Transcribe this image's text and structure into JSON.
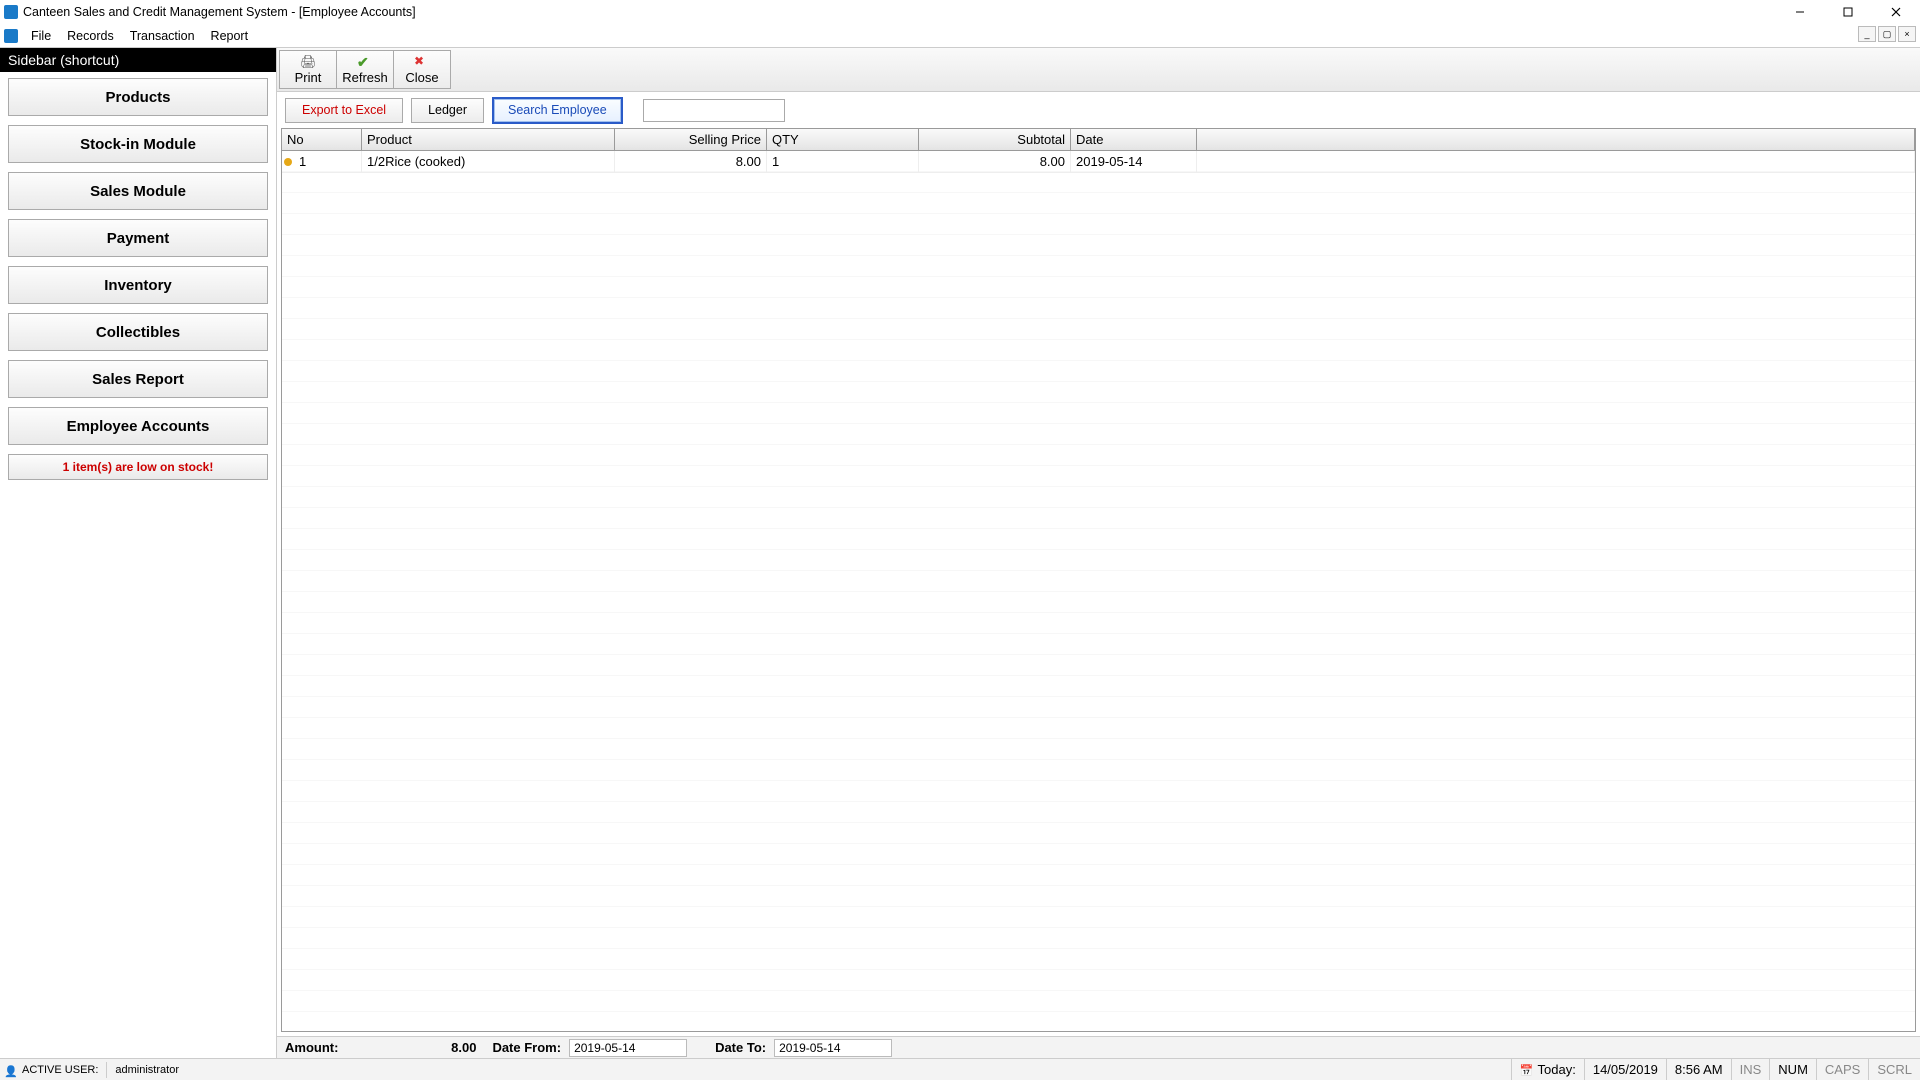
{
  "window": {
    "title": "Canteen Sales and Credit Management System - [Employee Accounts]"
  },
  "menubar": {
    "items": [
      "File",
      "Records",
      "Transaction",
      "Report"
    ]
  },
  "sidebar": {
    "header": "Sidebar (shortcut)",
    "items": [
      "Products",
      "Stock-in Module",
      "Sales Module",
      "Payment",
      "Inventory",
      "Collectibles",
      "Sales Report",
      "Employee Accounts"
    ],
    "low_stock": "1 item(s) are low on stock!"
  },
  "toolbar": {
    "print": "Print",
    "refresh": "Refresh",
    "close": "Close"
  },
  "actions": {
    "export": "Export to Excel",
    "ledger": "Ledger",
    "search": "Search Employee",
    "search_value": ""
  },
  "grid": {
    "columns": {
      "no": "No",
      "product": "Product",
      "price": "Selling Price",
      "qty": "QTY",
      "subtotal": "Subtotal",
      "date": "Date"
    },
    "rows": [
      {
        "no": "1",
        "product": "1/2Rice (cooked)",
        "price": "8.00",
        "qty": "1",
        "subtotal": "8.00",
        "date": "2019-05-14"
      }
    ]
  },
  "summary": {
    "amount_label": "Amount:",
    "amount_value": "8.00",
    "date_from_label": "Date From:",
    "date_from_value": "2019-05-14",
    "date_to_label": "Date To:",
    "date_to_value": "2019-05-14"
  },
  "statusbar": {
    "active_user_label": "ACTIVE USER:",
    "active_user_value": "administrator",
    "today_label": "Today:",
    "today_date": "14/05/2019",
    "today_time": "8:56 AM",
    "ins": "INS",
    "num": "NUM",
    "caps": "CAPS",
    "scrl": "SCRL"
  }
}
